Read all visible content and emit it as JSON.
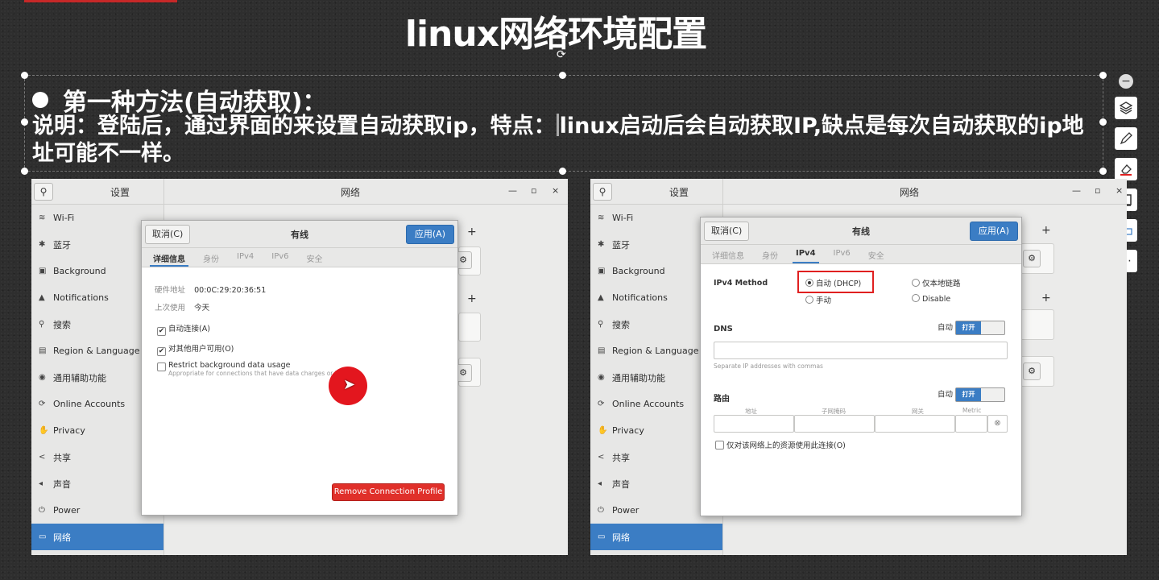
{
  "slide": {
    "title": "linux网络环境配置",
    "heading": "第一种方法(自动获取)：",
    "desc_part1": "说明：登陆后，通过界面的来设置自动获取ip，特点：",
    "desc_part2": "linux启动后会自动获取IP,缺点是每次自动获取的ip地址可能不一样。"
  },
  "toolbar": {
    "items": [
      "minimize-icon",
      "layers-icon",
      "pen-icon",
      "eraser-icon",
      "frame-icon",
      "text-icon",
      "more-icon"
    ],
    "more_label": "⋯"
  },
  "settings": {
    "app_title": "设置",
    "panel_title": "网络",
    "controls": {
      "min": "—",
      "max": "▫",
      "close": "×"
    },
    "sidebar_items": [
      {
        "label": "Wi-Fi",
        "icon": "wifi-icon",
        "glyph": "≋"
      },
      {
        "label": "蓝牙",
        "icon": "bluetooth-icon",
        "glyph": "✱"
      },
      {
        "label": "Background",
        "icon": "background-icon",
        "glyph": "▣"
      },
      {
        "label": "Notifications",
        "icon": "bell-icon",
        "glyph": "▲"
      },
      {
        "label": "搜索",
        "icon": "search-icon",
        "glyph": "⚲"
      },
      {
        "label": "Region & Language",
        "icon": "region-icon",
        "glyph": "▤"
      },
      {
        "label": "通用辅助功能",
        "icon": "accessibility-icon",
        "glyph": "◉"
      },
      {
        "label": "Online Accounts",
        "icon": "online-accounts-icon",
        "glyph": "⟳"
      },
      {
        "label": "Privacy",
        "icon": "privacy-icon",
        "glyph": "✋"
      },
      {
        "label": "共享",
        "icon": "share-icon",
        "glyph": "<"
      },
      {
        "label": "声音",
        "icon": "sound-icon",
        "glyph": "◂"
      },
      {
        "label": "Power",
        "icon": "power-icon",
        "glyph": "⏻"
      },
      {
        "label": "网络",
        "icon": "network-icon",
        "glyph": "▭"
      }
    ],
    "active_index": 12
  },
  "dialog_left": {
    "cancel": "取消(C)",
    "title": "有线",
    "apply": "应用(A)",
    "tabs": [
      "详细信息",
      "身份",
      "IPv4",
      "IPv6",
      "安全"
    ],
    "active_tab": 0,
    "hw_label": "硬件地址",
    "hw_value": "00:0C:29:20:36:51",
    "last_used_label": "上次使用",
    "last_used_value": "今天",
    "auto_connect": "自动连接(A)",
    "other_users": "对其他用户可用(O)",
    "restrict_label": "Restrict background data usage",
    "restrict_hint": "Appropriate for connections that have data charges or limits",
    "remove": "Remove Connection Profile"
  },
  "dialog_right": {
    "cancel": "取消(C)",
    "title": "有线",
    "apply": "应用(A)",
    "tabs": [
      "详细信息",
      "身份",
      "IPv4",
      "IPv6",
      "安全"
    ],
    "active_tab": 2,
    "method_label": "IPv4 Method",
    "method_auto": "自动 (DHCP)",
    "method_local": "仅本地链路",
    "method_manual": "手动",
    "method_disable": "Disable",
    "dns_label": "DNS",
    "auto_label": "自动",
    "switch_on": "打开",
    "dns_hint": "Separate IP addresses with commas",
    "routes_label": "路由",
    "col_address": "地址",
    "col_netmask": "子网掩码",
    "col_gateway": "网关",
    "col_metric": "Metric",
    "only_resources": "仅对该网络上的资源使用此连接(O)"
  },
  "colors": {
    "accent_blue": "#3b7dc4",
    "remove_red": "#e0302a",
    "highlight_red": "#e02020"
  }
}
